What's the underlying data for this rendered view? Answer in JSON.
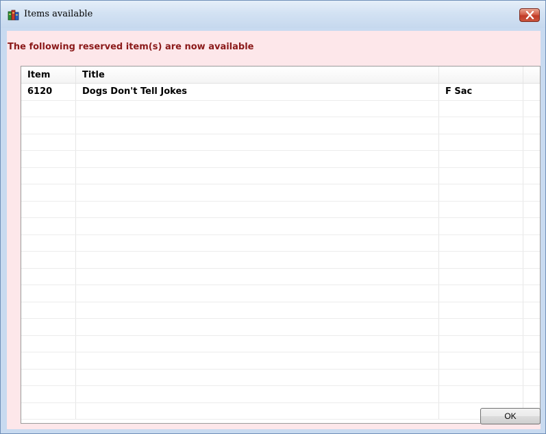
{
  "window": {
    "title": "Items available",
    "icon": "books-icon",
    "close_icon": "close-icon"
  },
  "message": "The following reserved item(s) are now available",
  "table": {
    "columns": [
      "Item",
      "Title",
      "",
      ""
    ],
    "rows": [
      [
        "6120",
        "Dogs Don't Tell Jokes",
        "F Sac",
        ""
      ],
      [
        "",
        "",
        "",
        ""
      ],
      [
        "",
        "",
        "",
        ""
      ],
      [
        "",
        "",
        "",
        ""
      ],
      [
        "",
        "",
        "",
        ""
      ],
      [
        "",
        "",
        "",
        ""
      ],
      [
        "",
        "",
        "",
        ""
      ],
      [
        "",
        "",
        "",
        ""
      ],
      [
        "",
        "",
        "",
        ""
      ],
      [
        "",
        "",
        "",
        ""
      ],
      [
        "",
        "",
        "",
        ""
      ],
      [
        "",
        "",
        "",
        ""
      ],
      [
        "",
        "",
        "",
        ""
      ],
      [
        "",
        "",
        "",
        ""
      ],
      [
        "",
        "",
        "",
        ""
      ],
      [
        "",
        "",
        "",
        ""
      ],
      [
        "",
        "",
        "",
        ""
      ],
      [
        "",
        "",
        "",
        ""
      ],
      [
        "",
        "",
        "",
        ""
      ],
      [
        "",
        "",
        "",
        ""
      ]
    ]
  },
  "buttons": {
    "ok_label": "OK"
  },
  "colors": {
    "message_text": "#8b1a1a",
    "client_background": "#fde7ea",
    "title_bar": "#d3e2f3",
    "close_button": "#c13b28"
  }
}
